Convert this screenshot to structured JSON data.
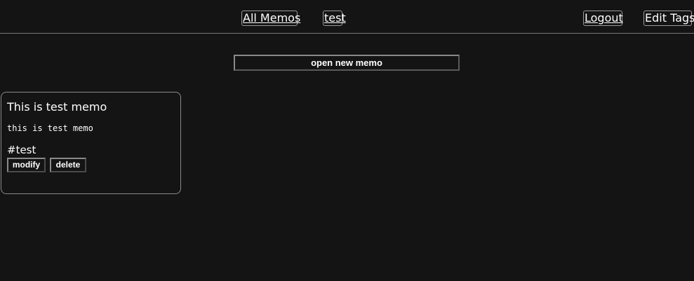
{
  "nav": {
    "all_memos": "All Memos",
    "test": "test",
    "logout": "Logout",
    "edit_tags": "Edit Tags"
  },
  "toolbar": {
    "new_memo_label": "open new memo"
  },
  "memos": [
    {
      "title": "This is test memo",
      "body": "this is test memo",
      "tag": "#test",
      "modify_label": "modify",
      "delete_label": "delete"
    }
  ],
  "colors": {
    "background": "#141414",
    "text": "#ffffff",
    "border": "#8a8a8a"
  }
}
